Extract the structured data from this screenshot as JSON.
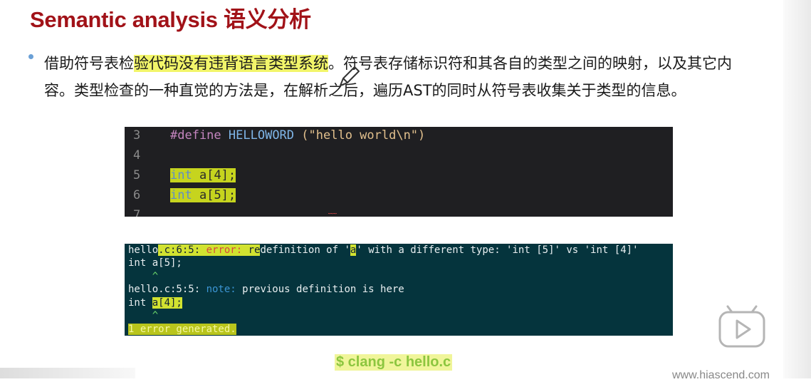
{
  "slide": {
    "title": "Semantic analysis 语义分析",
    "para": {
      "p1": "借助符号表检",
      "p1_hl": "验代码没有违背语言类型系统",
      "p2": "。符号表存储标识符和其各自的类型之间的映射，以及其它内容。类型检查的一种直觉的方法是，在解析之后，遍历AST的同时从符号表收集关于类型的信息。"
    },
    "command": "$ clang -c hello.c",
    "site": "www.hiascend.com"
  },
  "code": {
    "lines": [
      {
        "num": "3",
        "def": "#define",
        "mac": "HELLOWORD",
        "str": "(\"hello world\\n\")"
      },
      {
        "num": "4"
      },
      {
        "num": "5",
        "type": "int",
        "rest": "a[4];"
      },
      {
        "num": "6",
        "type": "int",
        "rest": "a[5];"
      },
      {
        "num": "7"
      }
    ]
  },
  "terminal": {
    "l1_a": "hello",
    "l1_b": ".c",
    "l1_c": ":6:5: ",
    "l1_err": "error: ",
    "l1_re": "re",
    "l1_d": "definition of '",
    "l1_a_var": "a",
    "l1_e": "' with a different type: 'int [5]' vs 'int [4]'",
    "l2": "int a[5];",
    "l3": "    ^",
    "l4_a": "hello.c:5:5: ",
    "l4_note": "note: ",
    "l4_b": "previous definition is here",
    "l5_a": "int ",
    "l5_b": "a[4];",
    "l6": "    ^",
    "l7": "1 error generated."
  },
  "colors": {
    "title": "#a11218",
    "highlight": "#f2f56a",
    "code_bg": "#1f1f22",
    "terminal_bg": "#05343d",
    "error": "#d64a3c",
    "note": "#3c95d4",
    "command": "#8cc63f"
  },
  "icons": [
    "pen-icon",
    "play-icon"
  ]
}
